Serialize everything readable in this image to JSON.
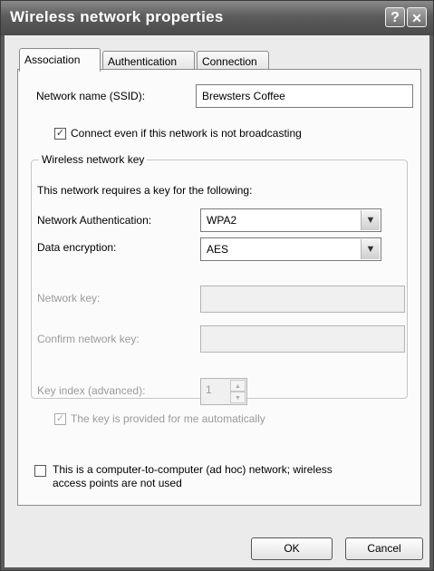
{
  "window": {
    "title": "Wireless network properties",
    "help_glyph": "?",
    "close_glyph": "✕"
  },
  "tabs": [
    {
      "label": "Association",
      "active": true
    },
    {
      "label": "Authentication",
      "active": false
    },
    {
      "label": "Connection",
      "active": false
    }
  ],
  "association": {
    "ssid_label": "Network name (SSID):",
    "ssid_value": "Brewsters Coffee",
    "broadcast_checkbox": {
      "label": "Connect even if this network is not broadcasting",
      "checked": true
    },
    "key_group": {
      "legend": "Wireless network key",
      "intro": "This network requires a key for the following:",
      "auth_label": "Network Authentication:",
      "auth_value": "WPA2",
      "encryption_label": "Data encryption:",
      "encryption_value": "AES",
      "network_key_label": "Network key:",
      "network_key_value": "",
      "confirm_key_label": "Confirm network key:",
      "confirm_key_value": "",
      "key_index_label": "Key index (advanced):",
      "key_index_value": "1",
      "auto_key_checkbox": {
        "label": "The key is provided for me automatically",
        "checked": true,
        "disabled": true
      }
    },
    "adhoc_checkbox": {
      "label_line1": "This is a computer-to-computer (ad hoc) network; wireless",
      "label_line2": "access points are not used",
      "checked": false
    }
  },
  "buttons": {
    "ok": "OK",
    "cancel": "Cancel"
  }
}
